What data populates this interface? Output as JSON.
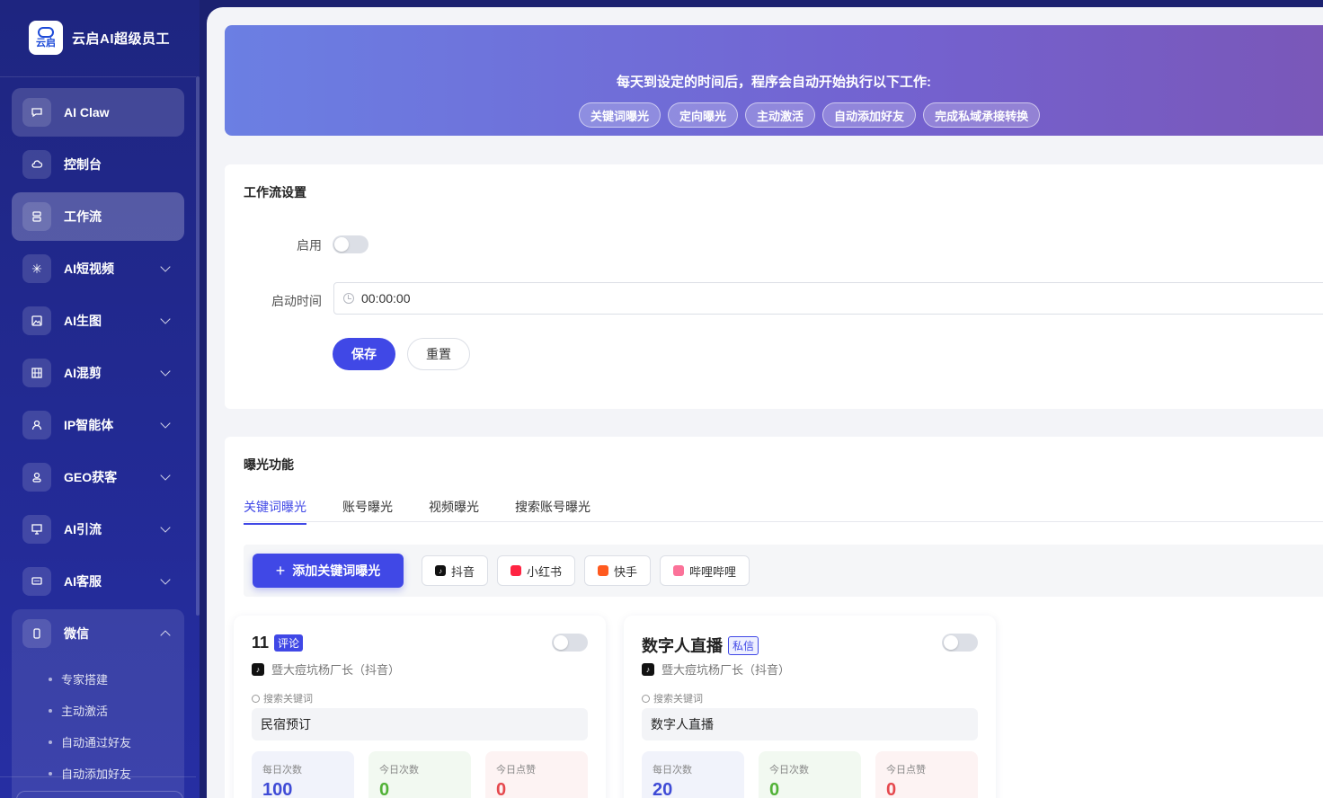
{
  "brand": {
    "name": "云启AI超级员工",
    "logo_text": "云启"
  },
  "sidebar": {
    "items": [
      {
        "label": "AI Claw",
        "icon": "chat-bubble-icon"
      },
      {
        "label": "控制台",
        "icon": "cloud-icon"
      },
      {
        "label": "工作流",
        "icon": "workflow-icon"
      },
      {
        "label": "AI短视频",
        "icon": "sparkle-icon"
      },
      {
        "label": "AI生图",
        "icon": "image-icon"
      },
      {
        "label": "AI混剪",
        "icon": "film-icon"
      },
      {
        "label": "IP智能体",
        "icon": "user-icon"
      },
      {
        "label": "GEO获客",
        "icon": "user-badge-icon"
      },
      {
        "label": "AI引流",
        "icon": "presentation-icon"
      },
      {
        "label": "AI客服",
        "icon": "message-icon"
      },
      {
        "label": "微信",
        "icon": "phone-icon"
      }
    ],
    "wechat_sub": [
      "专家搭建",
      "主动激活",
      "自动通过好友",
      "自动添加好友"
    ]
  },
  "banner": {
    "title": "每天到设定的时间后，程序会自动开始执行以下工作:",
    "tags": [
      "关键词曝光",
      "定向曝光",
      "主动激活",
      "自动添加好友",
      "完成私域承接转换"
    ]
  },
  "workflow": {
    "section_title": "工作流设置",
    "enable_label": "启用",
    "enabled": false,
    "start_time_label": "启动时间",
    "start_time_value": "00:00:00",
    "save_label": "保存",
    "reset_label": "重置"
  },
  "exposure": {
    "section_title": "曝光功能",
    "tabs": [
      "关键词曝光",
      "账号曝光",
      "视频曝光",
      "搜索账号曝光"
    ],
    "active_tab": 0,
    "add_button": "添加关键词曝光",
    "platforms": [
      {
        "label": "抖音",
        "color": "#111111"
      },
      {
        "label": "小红书",
        "color": "#ff2442"
      },
      {
        "label": "快手",
        "color": "#ff5a1f"
      },
      {
        "label": "哔哩哔哩",
        "color": "#fb7299"
      }
    ]
  },
  "cards": [
    {
      "title": "11",
      "badge": "评论",
      "account": "暨大痘坑杨厂长（抖音）",
      "search_label": "搜索关键词",
      "keyword": "民宿预订",
      "stats": [
        {
          "label": "每日次数",
          "value": "100"
        },
        {
          "label": "今日次数",
          "value": "0"
        },
        {
          "label": "今日点赞",
          "value": "0"
        }
      ]
    },
    {
      "title": "数字人直播",
      "badge": "私信",
      "account": "暨大痘坑杨厂长（抖音）",
      "search_label": "搜索关键词",
      "keyword": "数字人直播",
      "stats": [
        {
          "label": "每日次数",
          "value": "20"
        },
        {
          "label": "今日次数",
          "value": "0"
        },
        {
          "label": "今日点赞",
          "value": "0"
        }
      ]
    }
  ]
}
